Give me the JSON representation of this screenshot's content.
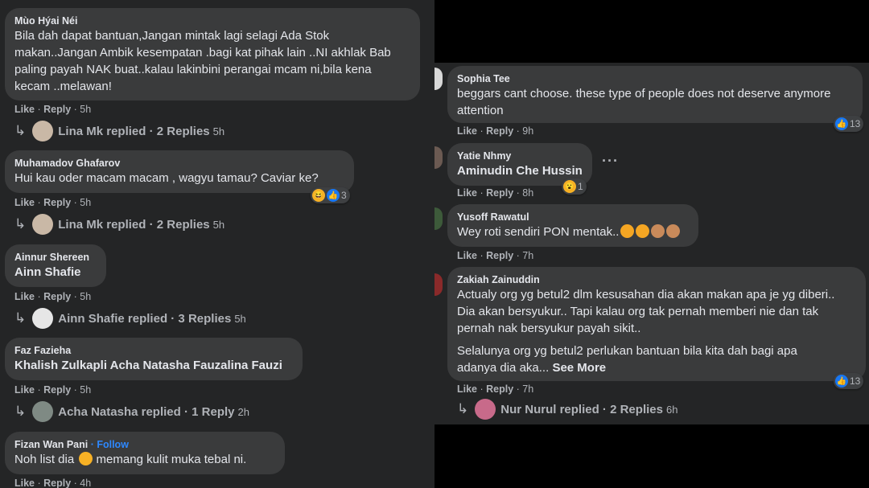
{
  "left": {
    "comments": [
      {
        "author": "Mùo Hýai Néi",
        "lines": [
          "Bila dah dapat bantuan,Jangan mintak lagi selagi Ada Stok",
          "makan..Jangan Ambik kesempatan .bagi kat pihak lain ..NI akhlak Bab",
          "paling payah NAK buat..kalau lakinbini perangai mcam ni,bila kena",
          "kecam ..melawan!"
        ],
        "like": "Like",
        "reply": "Reply",
        "time": "5h",
        "replied": {
          "text": "Lina Mk replied · 2 Replies",
          "time": "5h"
        }
      },
      {
        "author": "Muhamadov Ghafarov",
        "lines": [
          "Hui kau oder macam macam , wagyu tamau? Caviar ke?"
        ],
        "reactions": {
          "count": "3"
        },
        "like": "Like",
        "reply": "Reply",
        "time": "5h",
        "replied": {
          "text": "Lina Mk replied · 2 Replies",
          "time": "5h"
        }
      },
      {
        "author": "Ainnur Shereen",
        "tag": "Ainn Shafie",
        "like": "Like",
        "reply": "Reply",
        "time": "5h",
        "replied": {
          "text": "Ainn Shafie replied · 3 Replies",
          "time": "5h"
        }
      },
      {
        "author": "Faz Fazieha",
        "tag": "Khalish Zulkapli Acha Natasha Fauzalina Fauzi",
        "like": "Like",
        "reply": "Reply",
        "time": "5h",
        "replied": {
          "text": "Acha Natasha replied · 1 Reply",
          "time": "2h"
        }
      },
      {
        "author": "Fizan Wan Pani",
        "follow": "· Follow",
        "text_before": "Noh list dia",
        "text_after": "memang kulit muka tebal ni.",
        "like": "Like",
        "reply": "Reply",
        "time": "4h"
      }
    ]
  },
  "right": {
    "comments": [
      {
        "author": "Sophia Tee",
        "lines": [
          "beggars cant choose. these type of people does not deserve anymore",
          "attention"
        ],
        "reactions": {
          "count": "13"
        },
        "like": "Like",
        "reply": "Reply",
        "time": "9h"
      },
      {
        "author": "Yatie Nhmy",
        "tag": "Aminudin Che Hussin",
        "reactions": {
          "count": "1"
        },
        "more": "···",
        "like": "Like",
        "reply": "Reply",
        "time": "8h"
      },
      {
        "author": "Yusoff Rawatul",
        "text_before": "Wey roti sendiri PON mentak..",
        "like": "Like",
        "reply": "Reply",
        "time": "7h"
      },
      {
        "author": "Zakiah Zainuddin",
        "lines": [
          "Actualy org yg betul2 dlm kesusahan dia akan makan apa je yg diberi..",
          "Dia akan bersyukur.. Tapi kalau org tak pernah memberi nie dan tak",
          "pernah nak bersyukur payah sikit.."
        ],
        "lines2": [
          "Selalunya org yg betul2 perlukan bantuan bila kita dah bagi apa",
          "adanya dia aka..."
        ],
        "see_more": "See More",
        "reactions": {
          "count": "13"
        },
        "like": "Like",
        "reply": "Reply",
        "time": "7h",
        "replied": {
          "text": "Nur Nurul replied · 2 Replies",
          "time": "6h"
        }
      }
    ]
  },
  "colors": {
    "panel": "#242526",
    "bubble": "#3a3b3c",
    "text": "#e4e6eb",
    "muted": "#b0b3b8",
    "link": "#2d88ff",
    "like": "#1877f2"
  },
  "icons": [
    "reply-arrow-icon",
    "like-reaction-icon",
    "haha-reaction-icon",
    "wow-reaction-icon",
    "more-options-icon"
  ]
}
